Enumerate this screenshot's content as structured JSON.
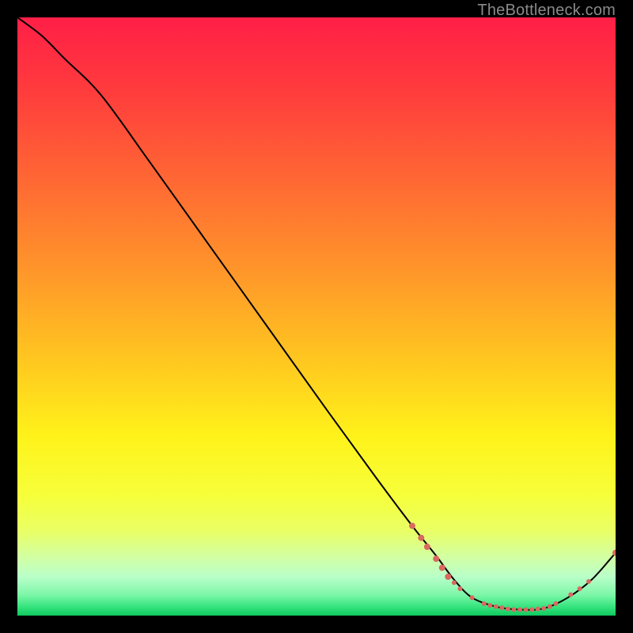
{
  "watermark": "TheBottleneck.com",
  "palette": {
    "marker": "#d86a60",
    "line": "#000000"
  },
  "chart_data": {
    "type": "line",
    "title": "",
    "xlabel": "",
    "ylabel": "",
    "xlim": [
      0,
      100
    ],
    "ylim": [
      0,
      100
    ],
    "background_gradient_stops": [
      {
        "offset": 0.0,
        "color": "#ff1f47"
      },
      {
        "offset": 0.12,
        "color": "#ff3b3d"
      },
      {
        "offset": 0.28,
        "color": "#ff6a33"
      },
      {
        "offset": 0.44,
        "color": "#ff9b29"
      },
      {
        "offset": 0.58,
        "color": "#ffc91f"
      },
      {
        "offset": 0.7,
        "color": "#fff21a"
      },
      {
        "offset": 0.8,
        "color": "#f6ff3a"
      },
      {
        "offset": 0.86,
        "color": "#e9ff66"
      },
      {
        "offset": 0.9,
        "color": "#d3ffa0"
      },
      {
        "offset": 0.935,
        "color": "#b9ffc9"
      },
      {
        "offset": 0.965,
        "color": "#7ef7a9"
      },
      {
        "offset": 0.985,
        "color": "#36e47e"
      },
      {
        "offset": 1.0,
        "color": "#0fc95f"
      }
    ],
    "series": [
      {
        "name": "curve",
        "x": [
          0,
          4,
          8,
          14,
          22,
          32,
          42,
          52,
          60,
          66,
          70,
          73,
          76,
          80,
          84,
          88,
          92,
          96,
          100
        ],
        "y": [
          100,
          97,
          93,
          87,
          76,
          62,
          48,
          34,
          23,
          15,
          10,
          6,
          3,
          1.5,
          1,
          1.2,
          3,
          6,
          10.5
        ]
      }
    ],
    "markers": [
      {
        "x": 66.0,
        "y": 15.0,
        "r": 4
      },
      {
        "x": 67.5,
        "y": 13.0,
        "r": 4
      },
      {
        "x": 68.5,
        "y": 11.5,
        "r": 4
      },
      {
        "x": 70.0,
        "y": 9.5,
        "r": 4
      },
      {
        "x": 71.0,
        "y": 8.0,
        "r": 4
      },
      {
        "x": 72.0,
        "y": 6.5,
        "r": 4
      },
      {
        "x": 73.0,
        "y": 5.5,
        "r": 3
      },
      {
        "x": 74.0,
        "y": 4.5,
        "r": 3
      },
      {
        "x": 76.0,
        "y": 3.0,
        "r": 3
      },
      {
        "x": 78.0,
        "y": 2.0,
        "r": 3
      },
      {
        "x": 79.0,
        "y": 1.7,
        "r": 3
      },
      {
        "x": 80.0,
        "y": 1.5,
        "r": 3
      },
      {
        "x": 81.0,
        "y": 1.3,
        "r": 3
      },
      {
        "x": 82.0,
        "y": 1.1,
        "r": 3
      },
      {
        "x": 83.0,
        "y": 1.0,
        "r": 3
      },
      {
        "x": 84.0,
        "y": 1.0,
        "r": 3
      },
      {
        "x": 85.0,
        "y": 1.0,
        "r": 3
      },
      {
        "x": 86.0,
        "y": 1.0,
        "r": 3
      },
      {
        "x": 87.0,
        "y": 1.1,
        "r": 3
      },
      {
        "x": 88.0,
        "y": 1.2,
        "r": 3
      },
      {
        "x": 89.0,
        "y": 1.5,
        "r": 3
      },
      {
        "x": 90.0,
        "y": 2.0,
        "r": 3
      },
      {
        "x": 92.5,
        "y": 3.5,
        "r": 3
      },
      {
        "x": 94.0,
        "y": 4.5,
        "r": 3
      },
      {
        "x": 95.5,
        "y": 5.7,
        "r": 3
      },
      {
        "x": 100.0,
        "y": 10.5,
        "r": 4
      }
    ]
  }
}
